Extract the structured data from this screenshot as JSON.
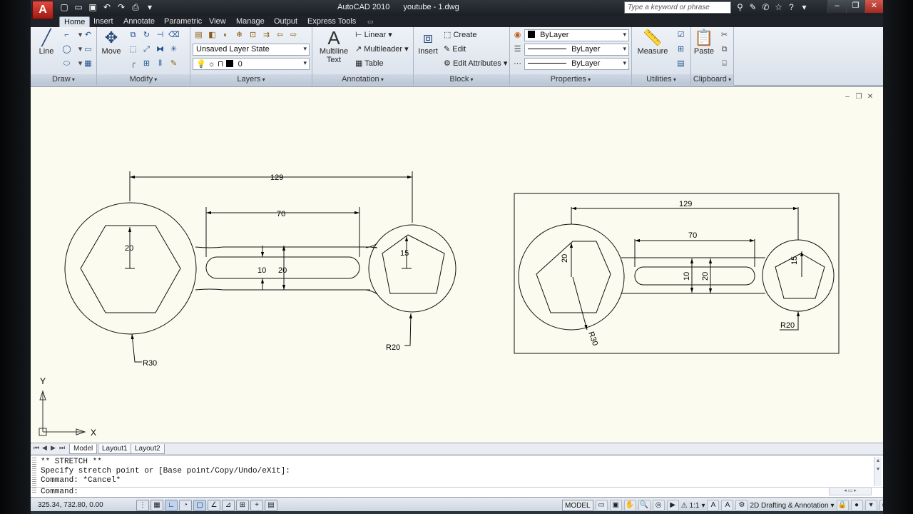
{
  "titlebar": {
    "app_button": "A",
    "app_name": "AutoCAD 2010",
    "file_name": "youtube - 1.dwg",
    "search_placeholder": "Type a keyword or phrase"
  },
  "tabs": [
    "Home",
    "Insert",
    "Annotate",
    "Parametric",
    "View",
    "Manage",
    "Output",
    "Express Tools"
  ],
  "ribbon": {
    "draw": {
      "title": "Draw",
      "line": "Line"
    },
    "modify": {
      "title": "Modify",
      "move": "Move"
    },
    "layers": {
      "title": "Layers",
      "layer_state": "Unsaved Layer State",
      "current_layer": "0"
    },
    "annotation": {
      "title": "Annotation",
      "mtext_line1": "Multiline",
      "mtext_line2": "Text",
      "linear": "Linear",
      "multileader": "Multileader",
      "table": "Table"
    },
    "block": {
      "title": "Block",
      "insert": "Insert",
      "create": "Create",
      "edit": "Edit",
      "edit_attributes": "Edit Attributes"
    },
    "properties": {
      "title": "Properties",
      "color": "ByLayer",
      "lineweight": "ByLayer",
      "linetype": "ByLayer"
    },
    "utilities": {
      "title": "Utilities",
      "measure": "Measure"
    },
    "clipboard": {
      "title": "Clipboard",
      "paste": "Paste"
    }
  },
  "drawing": {
    "dim_overall": "129",
    "dim_slot_length": "70",
    "dim_hex": "20",
    "dim_slot_width": "10",
    "dim_slot_outer": "20",
    "dim_pentagon": "15",
    "radius_large": "R30",
    "radius_small": "R20",
    "ucs_y": "Y",
    "ucs_x": "X"
  },
  "layout_tabs": [
    "Model",
    "Layout1",
    "Layout2"
  ],
  "command": {
    "line1": "** STRETCH **",
    "line2": "Specify stretch point or [Base point/Copy/Undo/eXit]:",
    "line3": "Command: *Cancel*",
    "prompt": "Command:"
  },
  "status": {
    "coordinates": "325.34, 732.80, 0.00",
    "model": "MODEL",
    "annotation_scale": "1:1",
    "workspace": "2D Drafting & Annotation"
  }
}
